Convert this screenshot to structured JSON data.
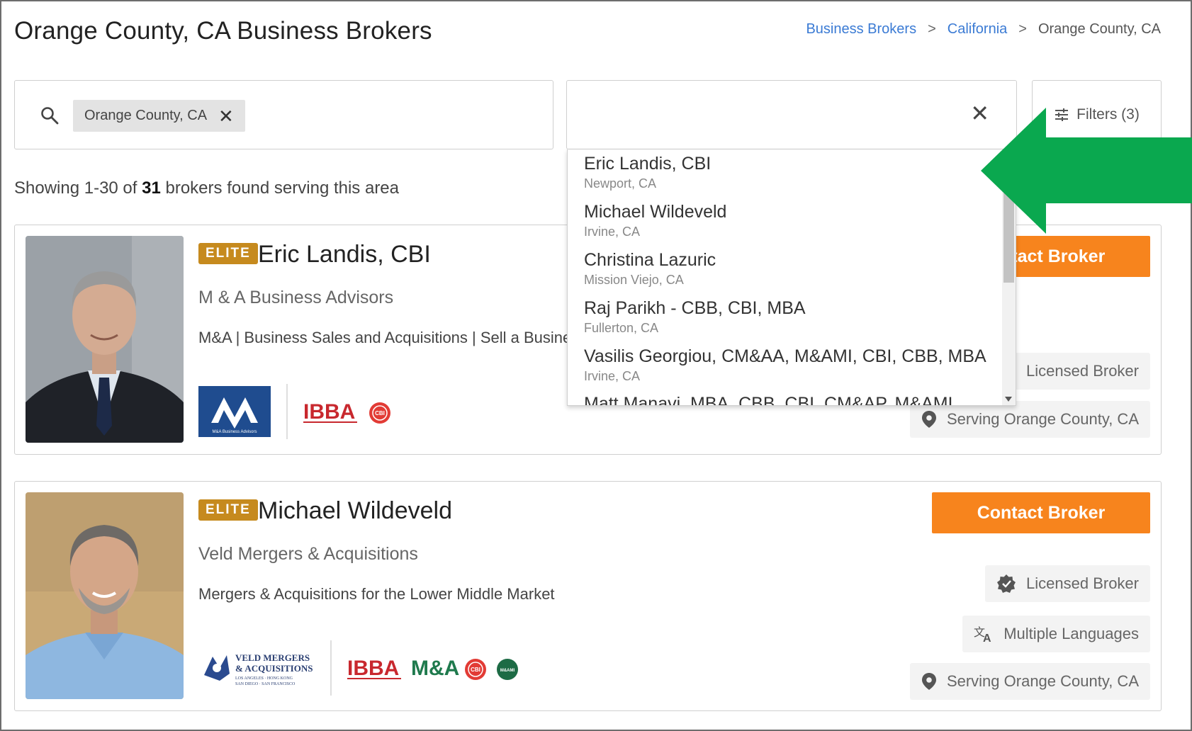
{
  "page": {
    "title": "Orange County, CA Business Brokers"
  },
  "breadcrumb": {
    "items": [
      "Business Brokers",
      "California",
      "Orange County, CA"
    ],
    "separator": ">"
  },
  "search": {
    "location_chip": "Orange County, CA",
    "name_query": "",
    "filters_label": "Filters (3)"
  },
  "results": {
    "prefix": "Showing 1-30 of ",
    "count": "31",
    "suffix": " brokers found serving this area"
  },
  "dropdown": {
    "items": [
      {
        "name": "Eric Landis, CBI",
        "location": "Newport, CA"
      },
      {
        "name": "Michael Wildeveld",
        "location": "Irvine, CA"
      },
      {
        "name": "Christina Lazuric",
        "location": "Mission Viejo, CA"
      },
      {
        "name": "Raj Parikh - CBB, CBI, MBA",
        "location": "Fullerton, CA"
      },
      {
        "name": "Vasilis Georgiou, CM&AA, M&AMI, CBI, CBB, MBA",
        "location": "Irvine, CA"
      },
      {
        "name": "Matt Manavi, MBA, CBB, CBI, CM&AP, M&AMI",
        "location": ""
      }
    ]
  },
  "brokers": [
    {
      "badge": "ELITE",
      "name": "Eric Landis, CBI",
      "company": "M & A Business Advisors",
      "tagline": "M&A | Business Sales and Acquisitions | Sell a Business",
      "contact_label": "Contact Broker",
      "licensed": "Licensed Broker",
      "serving": "Serving Orange County, CA",
      "logo_text": "M&A Business Advisors"
    },
    {
      "badge": "ELITE",
      "name": "Michael Wildeveld",
      "company": "Veld Mergers & Acquisitions",
      "tagline": "Mergers & Acquisitions for the Lower Middle Market",
      "contact_label": "Contact Broker",
      "licensed": "Licensed Broker",
      "languages": "Multiple Languages",
      "serving": "Serving Orange County, CA",
      "logo_text_1": "VELD MERGERS",
      "logo_text_2": "& ACQUISITIONS",
      "logo_text_3": "LOS ANGELES · HONG KONG",
      "logo_text_4": "SAN DIEGO · SAN FRANCISCO"
    }
  ],
  "association_logos": {
    "ibba": "IBBA",
    "cbi": "CBI",
    "mna": "M&A",
    "mami": "M&AMI"
  },
  "colors": {
    "accent_orange": "#f7841d",
    "elite_gold": "#c68a1e",
    "link_blue": "#3b7bd4",
    "annotation_green": "#0aa84f"
  }
}
